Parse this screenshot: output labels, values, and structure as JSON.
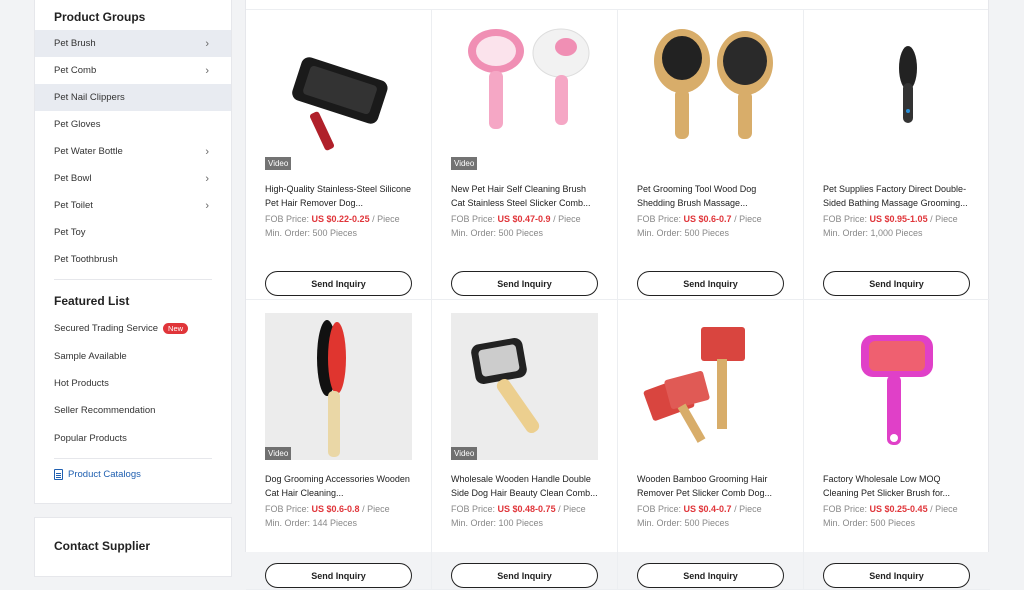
{
  "sidebar": {
    "groups_title": "Product Groups",
    "groups": [
      {
        "label": "Pet Brush",
        "chevron": true,
        "active": true
      },
      {
        "label": "Pet Comb",
        "chevron": true
      },
      {
        "label": "Pet Nail Clippers",
        "chevron": false,
        "hover": true
      },
      {
        "label": "Pet Gloves",
        "chevron": false
      },
      {
        "label": "Pet Water Bottle",
        "chevron": true
      },
      {
        "label": "Pet Bowl",
        "chevron": true
      },
      {
        "label": "Pet Toilet",
        "chevron": true
      },
      {
        "label": "Pet Toy",
        "chevron": false
      },
      {
        "label": "Pet Toothbrush",
        "chevron": false
      }
    ],
    "featured_title": "Featured List",
    "featured": [
      {
        "label": "Secured Trading Service",
        "badge": "New"
      },
      {
        "label": "Sample Available"
      },
      {
        "label": "Hot Products"
      },
      {
        "label": "Seller Recommendation"
      },
      {
        "label": "Popular Products"
      }
    ],
    "catalog_label": "Product Catalogs",
    "contact_title": "Contact Supplier"
  },
  "products": [
    {
      "title": "High-Quality Stainless-Steel Silicone Pet Hair Remover Dog...",
      "fob_label": "FOB Price:",
      "price": "US $0.22-0.25",
      "unit": "/ Piece",
      "min_order": "Min. Order: 500 Pieces",
      "video": "Video",
      "button": "Send Inquiry",
      "icon": "black-slicker-brush-image"
    },
    {
      "title": "New Pet Hair Self Cleaning Brush Cat Stainless Steel Slicker Comb...",
      "fob_label": "FOB Price:",
      "price": "US $0.47-0.9",
      "unit": "/ Piece",
      "min_order": "Min. Order: 500 Pieces",
      "video": "Video",
      "button": "Send Inquiry",
      "icon": "pink-self-cleaning-brush-image"
    },
    {
      "title": "Pet Grooming Tool Wood Dog Shedding Brush Massage...",
      "fob_label": "FOB Price:",
      "price": "US $0.6-0.7",
      "unit": "/ Piece",
      "min_order": "Min. Order: 500 Pieces",
      "video": "",
      "button": "Send Inquiry",
      "icon": "wooden-paddle-brush-image"
    },
    {
      "title": "Pet Supplies Factory Direct Double-Sided Bathing Massage Grooming...",
      "fob_label": "FOB Price:",
      "price": "US $0.95-1.05",
      "unit": "/ Piece",
      "min_order": "Min. Order: 1,000 Pieces",
      "video": "",
      "button": "Send Inquiry",
      "icon": "black-double-sided-brush-image"
    },
    {
      "title": "Dog Grooming Accessories Wooden Cat Hair Cleaning...",
      "fob_label": "FOB Price:",
      "price": "US $0.6-0.8",
      "unit": "/ Piece",
      "min_order": "Min. Order: 144 Pieces",
      "video": "Video",
      "button": "Send Inquiry",
      "icon": "wooden-pin-brush-image"
    },
    {
      "title": "Wholesale Wooden Handle Double Side Dog Hair Beauty Clean Comb...",
      "fob_label": "FOB Price:",
      "price": "US $0.48-0.75",
      "unit": "/ Piece",
      "min_order": "Min. Order: 100 Pieces",
      "video": "Video",
      "button": "Send Inquiry",
      "icon": "wooden-handle-slicker-image"
    },
    {
      "title": "Wooden Bamboo Grooming Hair Remover Pet Slicker Comb Dog...",
      "fob_label": "FOB Price:",
      "price": "US $0.4-0.7",
      "unit": "/ Piece",
      "min_order": "Min. Order: 500 Pieces",
      "video": "",
      "button": "Send Inquiry",
      "icon": "red-slicker-set-image"
    },
    {
      "title": "Factory Wholesale Low MOQ Cleaning Pet Slicker Brush for...",
      "fob_label": "FOB Price:",
      "price": "US $0.25-0.45",
      "unit": "/ Piece",
      "min_order": "Min. Order: 500 Pieces",
      "video": "",
      "button": "Send Inquiry",
      "icon": "pink-slicker-brush-image"
    }
  ],
  "colors": {
    "price": "#e0353a",
    "badge": "#e0353a",
    "link": "#1f5fb0"
  }
}
